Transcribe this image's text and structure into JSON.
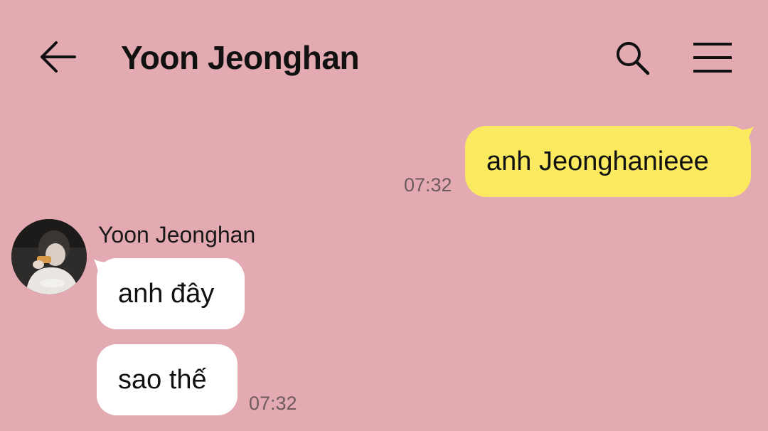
{
  "header": {
    "title": "Yoon Jeonghan",
    "back_icon": "arrow-left-icon",
    "search_icon": "search-icon",
    "menu_icon": "hamburger-menu-icon"
  },
  "colors": {
    "background": "#e3aab2",
    "outgoing_bubble": "#fbe960",
    "incoming_bubble": "#ffffff"
  },
  "messages": {
    "outgoing": [
      {
        "text": "anh Jeonghanieee",
        "time": "07:32"
      }
    ],
    "incoming": {
      "sender": "Yoon Jeonghan",
      "items": [
        {
          "text": "anh đây"
        },
        {
          "text": "sao thế",
          "time": "07:32"
        }
      ]
    }
  }
}
